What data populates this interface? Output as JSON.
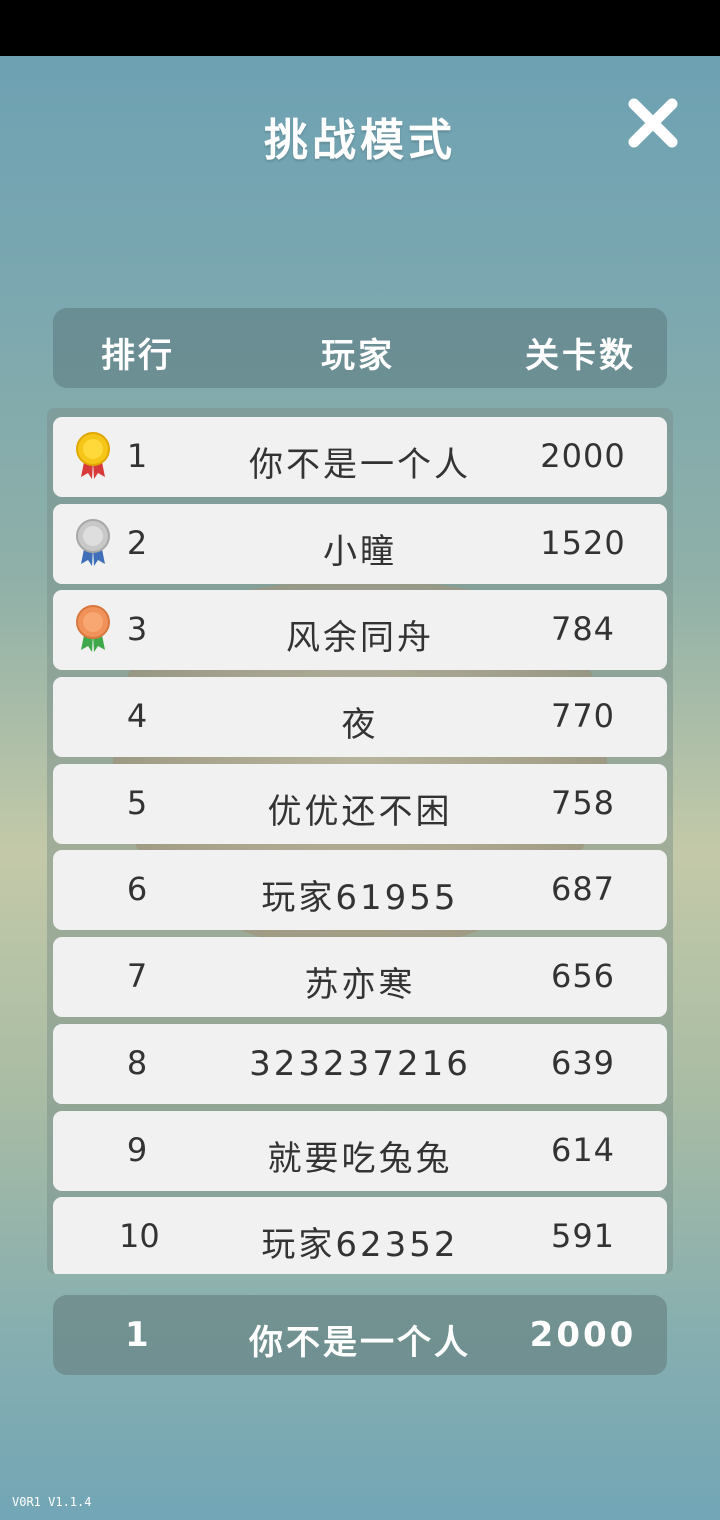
{
  "header": {
    "title": "挑战模式"
  },
  "columns": {
    "rank": "排行",
    "player": "玩家",
    "levels": "关卡数"
  },
  "leaderboard": [
    {
      "rank": "1",
      "name": "你不是一个人",
      "levels": "2000",
      "medal": "gold-medal"
    },
    {
      "rank": "2",
      "name": "小瞳",
      "levels": "1520",
      "medal": "silver-medal"
    },
    {
      "rank": "3",
      "name": "风余同舟",
      "levels": "784",
      "medal": "bronze-medal"
    },
    {
      "rank": "4",
      "name": "夜",
      "levels": "770"
    },
    {
      "rank": "5",
      "name": "优优还不困",
      "levels": "758"
    },
    {
      "rank": "6",
      "name": "玩家61955",
      "levels": "687"
    },
    {
      "rank": "7",
      "name": "苏亦寒",
      "levels": "656"
    },
    {
      "rank": "8",
      "name": "323237216",
      "levels": "639"
    },
    {
      "rank": "9",
      "name": "就要吃兔兔",
      "levels": "614"
    },
    {
      "rank": "10",
      "name": "玩家62352",
      "levels": "591"
    }
  ],
  "self": {
    "rank": "1",
    "name": "你不是一个人",
    "levels": "2000"
  },
  "version": "V0R1 V1.1.4",
  "colors": {
    "gold": "#f5c518",
    "silver": "#c8c8c8",
    "bronze": "#f0925a"
  }
}
